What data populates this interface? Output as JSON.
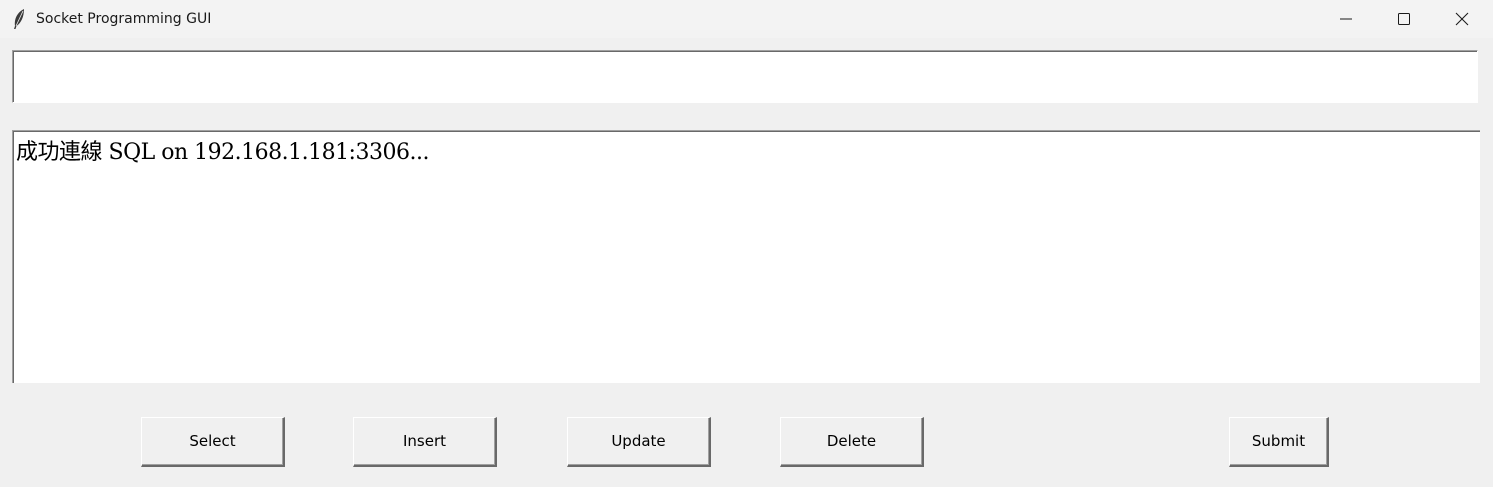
{
  "window": {
    "title": "Socket Programming GUI",
    "app_icon": "feather-icon",
    "controls": {
      "minimize_icon": "minimize-icon",
      "maximize_icon": "maximize-icon",
      "close_icon": "close-icon"
    }
  },
  "input": {
    "value": "",
    "placeholder": ""
  },
  "output": {
    "text": "成功連線 SQL on 192.168.1.181:3306..."
  },
  "buttons": {
    "select": "Select",
    "insert": "Insert",
    "update": "Update",
    "delete": "Delete",
    "submit": "Submit"
  }
}
